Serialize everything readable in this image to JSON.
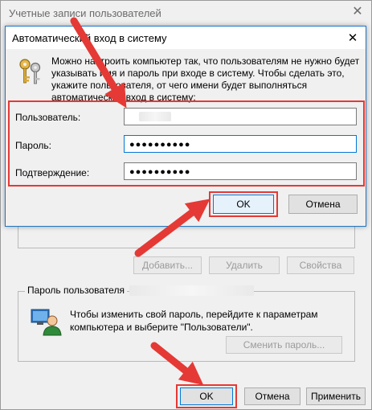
{
  "parent": {
    "title": "Учетные записи пользователей",
    "close_symbol": "✕",
    "buttons": {
      "add": "Добавить...",
      "delete": "Удалить",
      "properties": "Свойства",
      "change_password": "Сменить пароль...",
      "ok": "OK",
      "cancel": "Отмена",
      "apply": "Применить"
    },
    "password_group": {
      "title": "Пароль пользователя",
      "text_line1": "Чтобы изменить свой пароль, перейдите к параметрам",
      "text_line2": "компьютера и выберите \"Пользователи\"."
    }
  },
  "dialog": {
    "title": "Автоматический вход в систему",
    "close_symbol": "✕",
    "description": "Можно настроить компьютер так, что пользователям не нужно будет указывать имя и пароль при входе в систему. Чтобы сделать это, укажите пользователя, от чего имени будет выполняться автоматический вход в систему:",
    "fields": {
      "user_label": "Пользователь:",
      "password_label": "Пароль:",
      "password_value": "●●●●●●●●●●",
      "confirm_label": "Подтверждение:",
      "confirm_value": "●●●●●●●●●●"
    },
    "buttons": {
      "ok": "OK",
      "cancel": "Отмена"
    }
  },
  "colors": {
    "annotation_red": "#e53935",
    "focus_blue": "#0078d7"
  },
  "icons": [
    "keys-icon",
    "user-icon",
    "close-icon",
    "arrow-annotation"
  ]
}
